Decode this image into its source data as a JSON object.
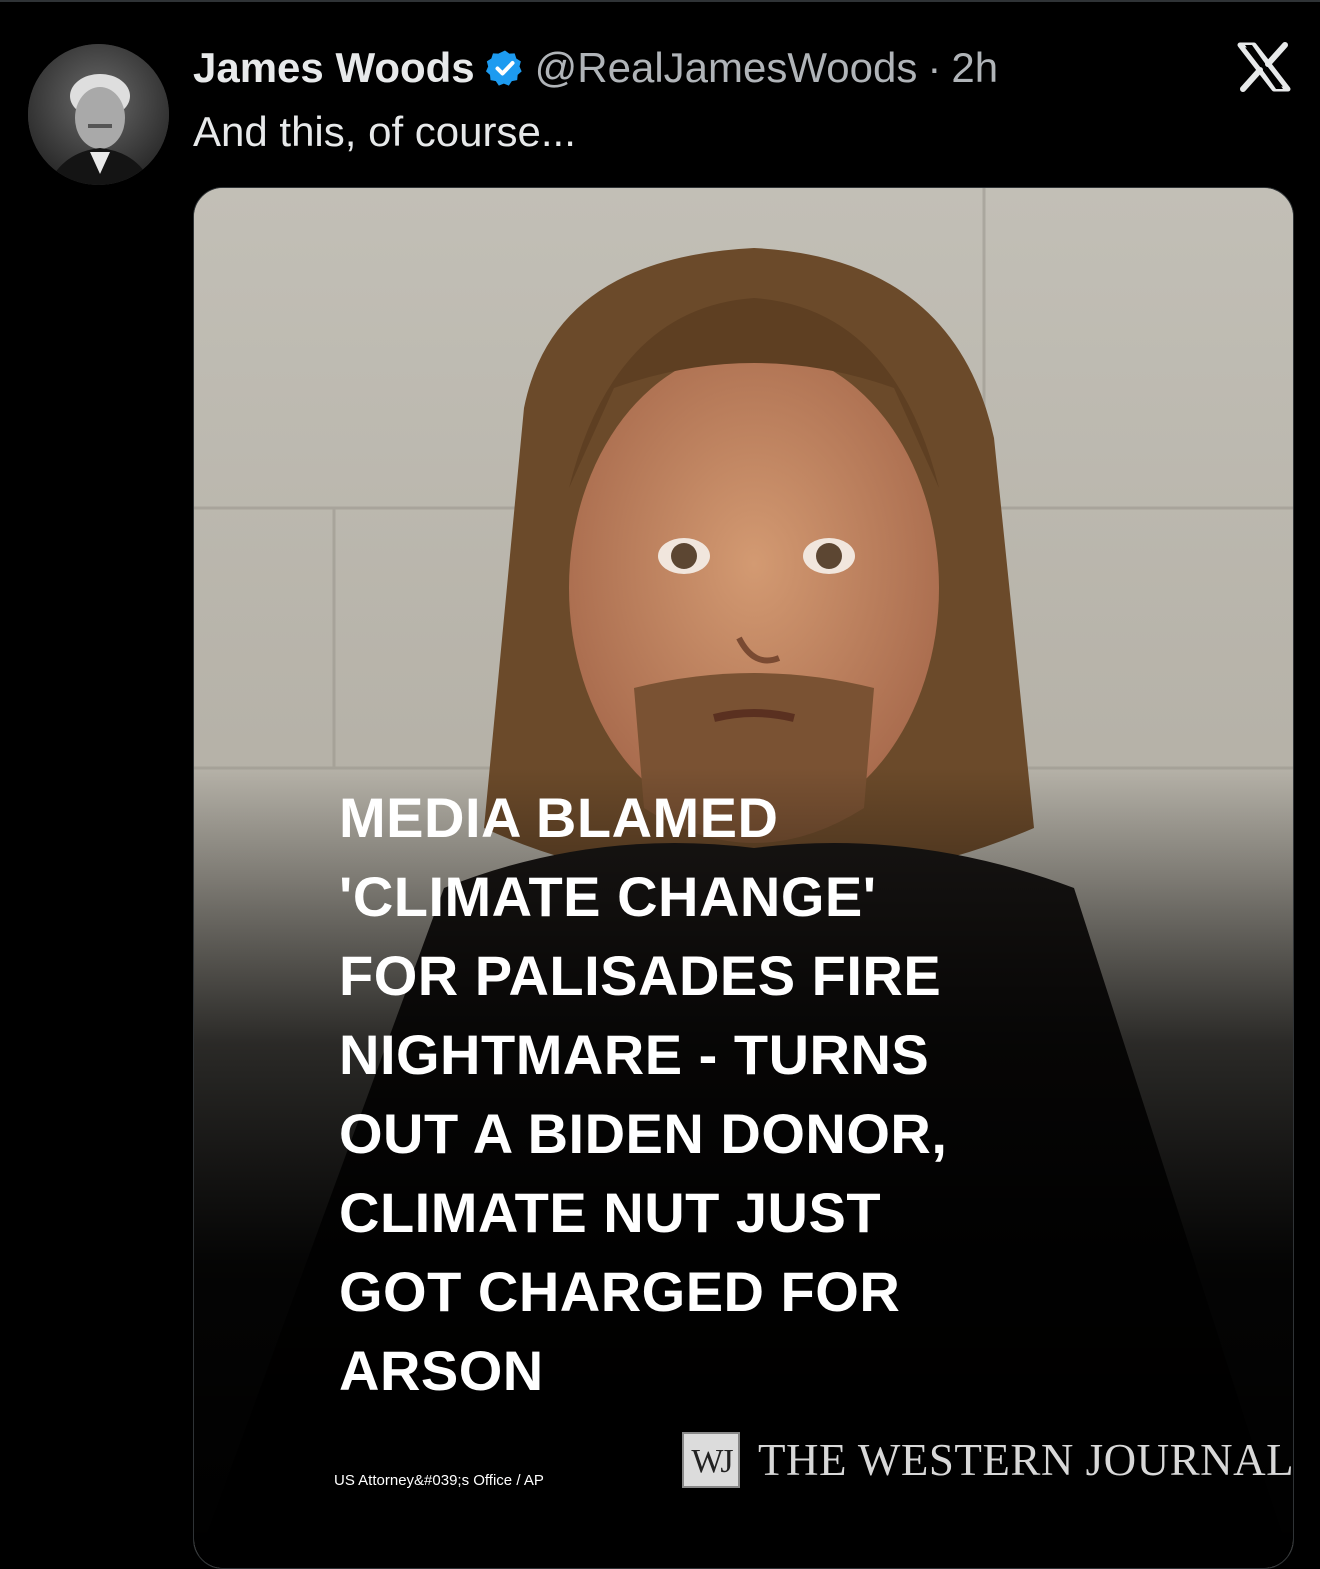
{
  "tweet": {
    "author_name": "James Woods",
    "handle": "@RealJamesWoods",
    "separator": "·",
    "time": "2h",
    "text": "And this, of course..."
  },
  "media": {
    "headline_lines": [
      "MEDIA BLAMED",
      "'CLIMATE CHANGE'",
      "FOR PALISADES FIRE",
      "NIGHTMARE - TURNS",
      "OUT A BIDEN DONOR,",
      "CLIMATE NUT JUST",
      "GOT CHARGED FOR",
      "ARSON"
    ],
    "photo_credit": "US Attorney&#039;s Office / AP",
    "brand_mark": "WJ",
    "brand_name": "THE WESTERN JOURNAL"
  },
  "icons": {
    "verified": "verified-badge-icon",
    "platform": "x-logo-icon"
  },
  "colors": {
    "background": "#000000",
    "text": "#e7e9ea",
    "secondary_text": "#b0b4b8",
    "verified_blue": "#1d9bf0"
  }
}
